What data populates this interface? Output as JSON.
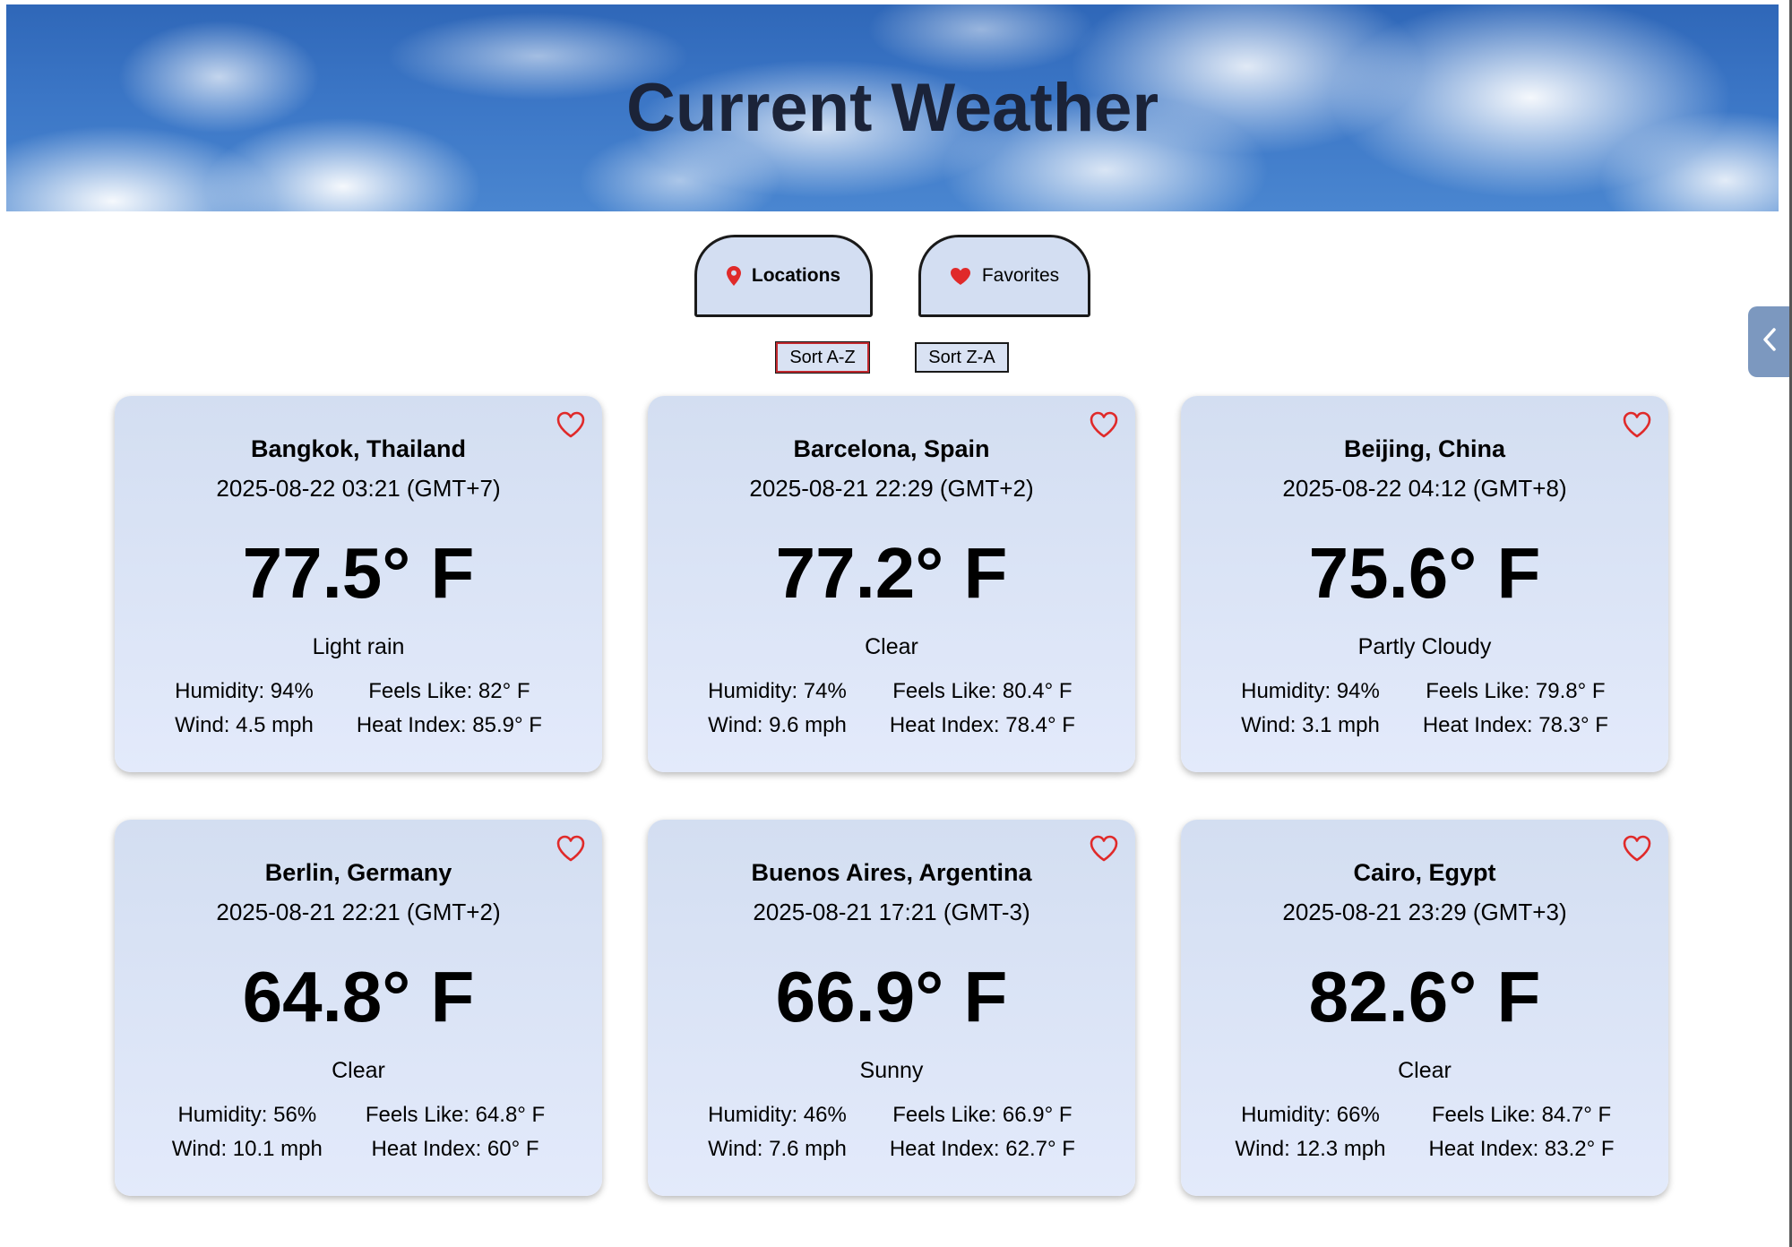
{
  "header": {
    "title": "Current Weather"
  },
  "tabs": {
    "locations_label": "Locations",
    "favorites_label": "Favorites"
  },
  "sort": {
    "az_label": "Sort A-Z",
    "za_label": "Sort Z-A"
  },
  "colors": {
    "accent_red": "#e02a2a",
    "card_bg": "#d9e3f5",
    "tab_bg": "#d3def2"
  },
  "icons": {
    "locations_tab": "map-pin-icon",
    "favorites_tab": "heart-filled-icon",
    "card_favorite": "heart-outline-icon",
    "side_toggle": "chevron-left-icon"
  },
  "cards": [
    {
      "city": "Bangkok, Thailand",
      "time": "2025-08-22 03:21 (GMT+7)",
      "temp": "77.5° F",
      "condition": "Light rain",
      "humidity": "Humidity: 94%",
      "wind": "Wind: 4.5 mph",
      "feels_like": "Feels Like: 82° F",
      "heat_index": "Heat Index: 85.9° F"
    },
    {
      "city": "Barcelona, Spain",
      "time": "2025-08-21 22:29 (GMT+2)",
      "temp": "77.2° F",
      "condition": "Clear",
      "humidity": "Humidity: 74%",
      "wind": "Wind: 9.6 mph",
      "feels_like": "Feels Like: 80.4° F",
      "heat_index": "Heat Index: 78.4° F"
    },
    {
      "city": "Beijing, China",
      "time": "2025-08-22 04:12 (GMT+8)",
      "temp": "75.6° F",
      "condition": "Partly Cloudy",
      "humidity": "Humidity: 94%",
      "wind": "Wind: 3.1 mph",
      "feels_like": "Feels Like: 79.8° F",
      "heat_index": "Heat Index: 78.3° F"
    },
    {
      "city": "Berlin, Germany",
      "time": "2025-08-21 22:21 (GMT+2)",
      "temp": "64.8° F",
      "condition": "Clear",
      "humidity": "Humidity: 56%",
      "wind": "Wind: 10.1 mph",
      "feels_like": "Feels Like: 64.8° F",
      "heat_index": "Heat Index: 60° F"
    },
    {
      "city": "Buenos Aires, Argentina",
      "time": "2025-08-21 17:21 (GMT-3)",
      "temp": "66.9° F",
      "condition": "Sunny",
      "humidity": "Humidity: 46%",
      "wind": "Wind: 7.6 mph",
      "feels_like": "Feels Like: 66.9° F",
      "heat_index": "Heat Index: 62.7° F"
    },
    {
      "city": "Cairo, Egypt",
      "time": "2025-08-21 23:29 (GMT+3)",
      "temp": "82.6° F",
      "condition": "Clear",
      "humidity": "Humidity: 66%",
      "wind": "Wind: 12.3 mph",
      "feels_like": "Feels Like: 84.7° F",
      "heat_index": "Heat Index: 83.2° F"
    }
  ]
}
